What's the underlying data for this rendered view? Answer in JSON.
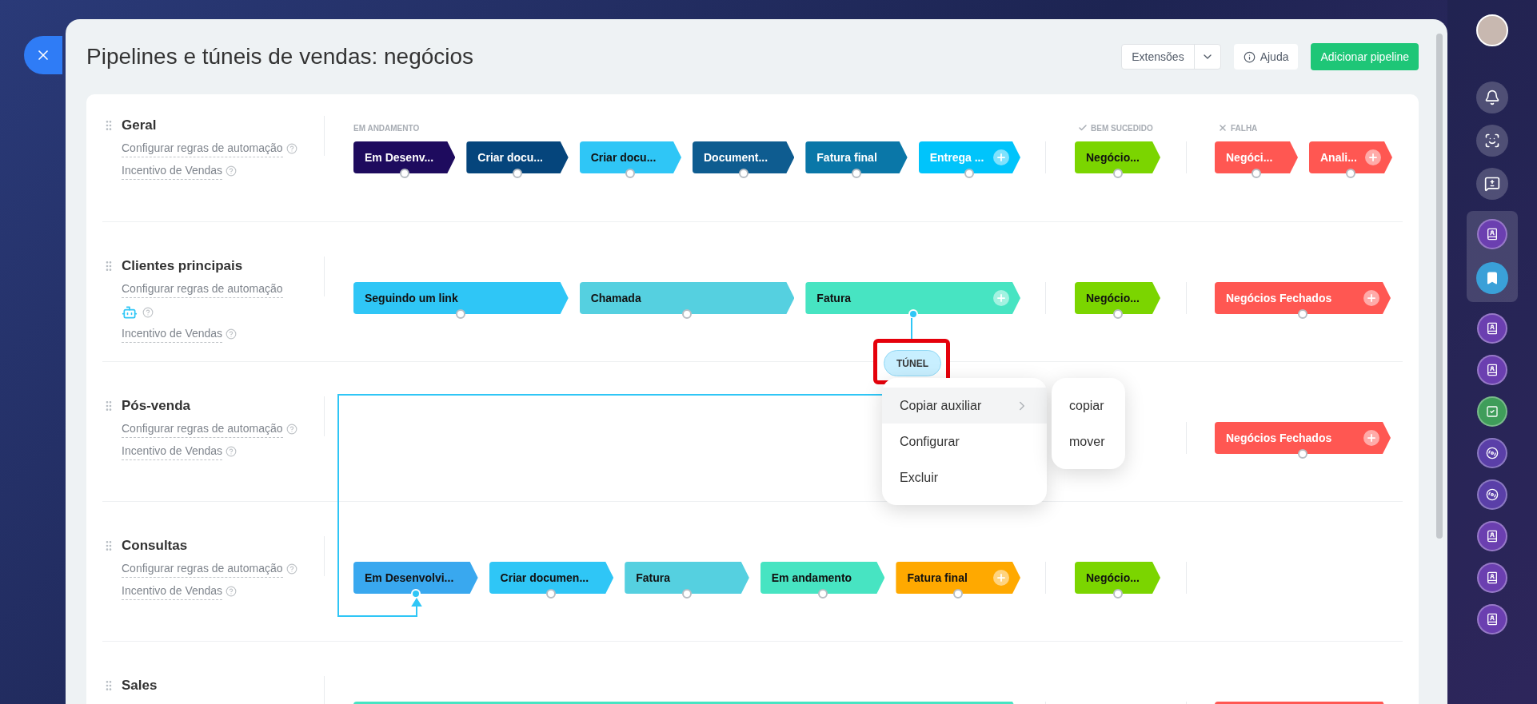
{
  "title": "Pipelines e túneis de vendas: negócios",
  "header_buttons": {
    "extensions": "Extensões",
    "help": "Ajuda",
    "add": "Adicionar pipeline"
  },
  "column_headers": {
    "in_progress": "EM ANDAMENTO",
    "success": "BEM SUCEDIDO",
    "failure": "FALHA"
  },
  "pipelines": [
    {
      "name": "Geral",
      "automation_link": "Configurar regras de automação",
      "incentive_link": "Incentivo de Vendas",
      "in_progress": [
        {
          "name": "Em Desenv...",
          "color": "#1e0b5e",
          "dark_label": false,
          "add": false,
          "connected": false
        },
        {
          "name": "Criar docu...",
          "color": "#05457c",
          "dark_label": false,
          "add": false,
          "connected": false
        },
        {
          "name": "Criar docu...",
          "color": "#2fc6f6",
          "dark_label": true,
          "add": false,
          "connected": false
        },
        {
          "name": "Document...",
          "color": "#0e5c90",
          "dark_label": false,
          "add": false,
          "connected": false
        },
        {
          "name": "Fatura final",
          "color": "#0a77a8",
          "dark_label": false,
          "add": false,
          "connected": false
        },
        {
          "name": "Entrega ...",
          "color": "#00c4fb",
          "dark_label": false,
          "add": true,
          "connected": false
        }
      ],
      "success": [
        {
          "name": "Negócio...",
          "color": "#7bd500",
          "dark_label": true,
          "add": false,
          "connected": false
        }
      ],
      "failure": [
        {
          "name": "Negóci...",
          "color": "#ff5752",
          "dark_label": false,
          "add": false,
          "connected": false
        },
        {
          "name": "Anali...",
          "color": "#ff5752",
          "dark_label": false,
          "add": true,
          "connected": false
        }
      ]
    },
    {
      "name": "Clientes principais",
      "automation_link": "Configurar regras de automação",
      "automation_robot": true,
      "incentive_link": "Incentivo de Vendas",
      "in_progress": [
        {
          "name": "Seguindo um link",
          "color": "#2fc6f6",
          "dark_label": true,
          "add": false,
          "connected": false
        },
        {
          "name": "Chamada",
          "color": "#55d0e0",
          "dark_label": true,
          "add": false,
          "connected": false
        },
        {
          "name": "Fatura",
          "color": "#47e4c2",
          "dark_label": true,
          "add": true,
          "connected": true
        }
      ],
      "success": [
        {
          "name": "Negócio...",
          "color": "#7bd500",
          "dark_label": true,
          "add": false,
          "connected": false
        }
      ],
      "failure": [
        {
          "name": "Negócios Fechados",
          "color": "#ff5752",
          "dark_label": false,
          "add": true,
          "connected": false
        }
      ]
    },
    {
      "name": "Pós-venda",
      "automation_link": "Configurar regras de automação",
      "incentive_link": "Incentivo de Vendas",
      "failure": [
        {
          "name": "Negócios Fechados",
          "color": "#ff5752",
          "dark_label": false,
          "add": true,
          "connected": false
        }
      ]
    },
    {
      "name": "Consultas",
      "automation_link": "Configurar regras de automação",
      "incentive_link": "Incentivo de Vendas",
      "in_progress": [
        {
          "name": "Em Desenvolvi...",
          "color": "#39a8ef",
          "dark_label": true,
          "add": false,
          "connected": true
        },
        {
          "name": "Criar documen...",
          "color": "#2fc6f6",
          "dark_label": true,
          "add": false,
          "connected": false
        },
        {
          "name": "Fatura",
          "color": "#55d0e0",
          "dark_label": true,
          "add": false,
          "connected": false
        },
        {
          "name": "Em andamento",
          "color": "#47e4c2",
          "dark_label": true,
          "add": false,
          "connected": false
        },
        {
          "name": "Fatura final",
          "color": "#ffa900",
          "dark_label": true,
          "add": true,
          "connected": false
        }
      ],
      "success": [
        {
          "name": "Negócio...",
          "color": "#7bd500",
          "dark_label": true,
          "add": false,
          "connected": false
        }
      ]
    },
    {
      "name": "Sales",
      "in_progress": [
        {
          "color": "#47e4c2"
        }
      ],
      "failure": [
        {
          "color": "#ff5752"
        }
      ]
    }
  ],
  "tunnel": {
    "label": "TÚNEL",
    "highlighted": true
  },
  "context_menu": {
    "items": [
      {
        "label": "Copiar auxiliar",
        "selected": true,
        "submenu": true
      },
      {
        "label": "Configurar",
        "selected": false,
        "submenu": false
      },
      {
        "label": "Excluir",
        "selected": false,
        "submenu": false
      }
    ],
    "submenu": [
      "copiar",
      "mover"
    ]
  }
}
